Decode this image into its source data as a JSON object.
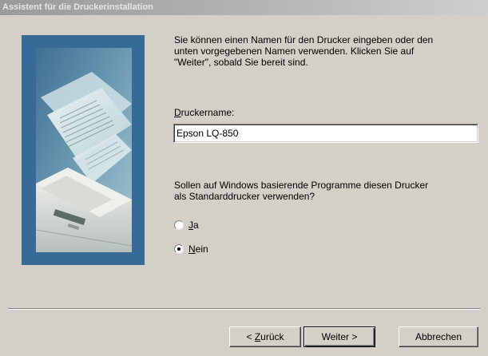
{
  "window": {
    "title": "Assistent für die Druckerinstallation"
  },
  "description": {
    "line1": "Sie können einen Namen für den Drucker eingeben oder den",
    "line2": "unten vorgegebenen Namen verwenden. Klicken Sie auf",
    "line3": "\"Weiter\", sobald Sie bereit sind."
  },
  "printer_name": {
    "label_accel": "D",
    "label_rest": "ruckername:",
    "value": "Epson LQ-850"
  },
  "default_question": {
    "line1": "Sollen auf Windows basierende Programme diesen Drucker",
    "line2": "als Standarddrucker verwenden?",
    "options": [
      {
        "accel": "J",
        "rest": "a",
        "selected": false
      },
      {
        "accel": "N",
        "rest": "ein",
        "selected": true
      }
    ]
  },
  "buttons": {
    "back_prefix": "< ",
    "back_accel": "Z",
    "back_rest": "urück",
    "next": "Weiter >",
    "cancel": "Abbrechen"
  },
  "colors": {
    "dialog_bg": "#d4d0c8",
    "picture_frame": "#376a96",
    "titlebar_inactive": "#9a9a9a"
  },
  "icons": {
    "wizard_picture": "printer-with-paper-illustration"
  }
}
